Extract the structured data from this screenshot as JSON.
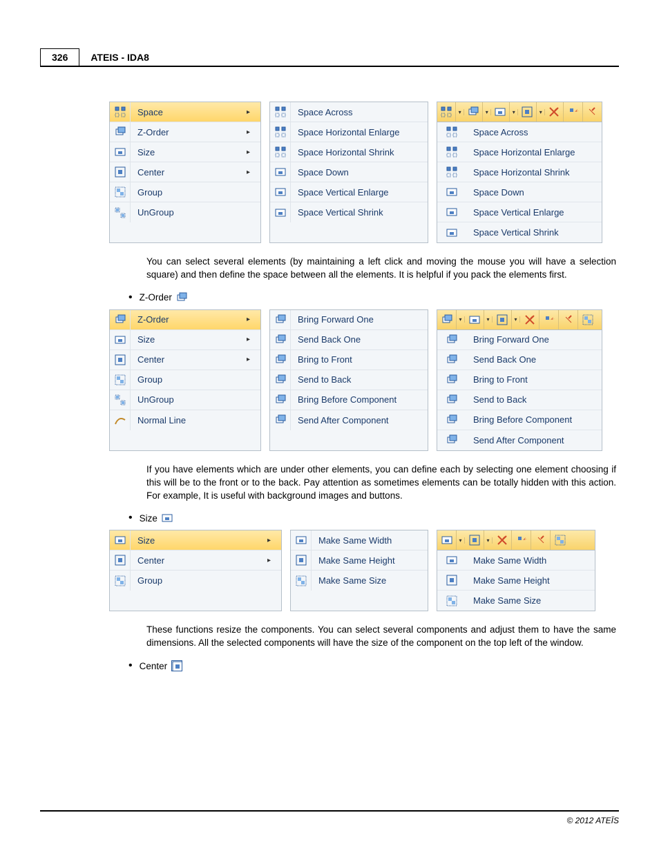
{
  "header": {
    "page_number": "326",
    "title": "ATEIS - IDA8"
  },
  "section1": {
    "menu1": [
      {
        "label": "Space",
        "selected": true,
        "arrow": true
      },
      {
        "label": "Z-Order",
        "arrow": true
      },
      {
        "label": "Size",
        "arrow": true
      },
      {
        "label": "Center",
        "arrow": true
      },
      {
        "label": "Group"
      },
      {
        "label": "UnGroup"
      }
    ],
    "menu2": [
      {
        "label": "Space Across"
      },
      {
        "label": "Space Horizontal Enlarge"
      },
      {
        "label": "Space Horizontal Shrink"
      },
      {
        "label": "Space Down"
      },
      {
        "label": "Space Vertical Enlarge"
      },
      {
        "label": "Space Vertical Shrink"
      }
    ],
    "panel": [
      {
        "label": "Space Across"
      },
      {
        "label": "Space Horizontal Enlarge"
      },
      {
        "label": "Space Horizontal Shrink"
      },
      {
        "label": "Space Down"
      },
      {
        "label": "Space Vertical Enlarge"
      },
      {
        "label": "Space Vertical Shrink"
      }
    ],
    "paragraph": "You can select several elements (by maintaining a left click and moving the mouse you will have a selection square) and then define the space between all the elements. It is helpful if you pack the elements first."
  },
  "section2": {
    "bullet": "Z-Order",
    "menu1": [
      {
        "label": "Z-Order",
        "selected": true,
        "arrow": true
      },
      {
        "label": "Size",
        "arrow": true
      },
      {
        "label": "Center",
        "arrow": true
      },
      {
        "label": "Group"
      },
      {
        "label": "UnGroup"
      },
      {
        "label": "Normal Line"
      }
    ],
    "menu2": [
      {
        "label": "Bring Forward One"
      },
      {
        "label": "Send Back One"
      },
      {
        "label": "Bring to Front"
      },
      {
        "label": "Send to Back"
      },
      {
        "label": "Bring Before Component"
      },
      {
        "label": "Send After Component"
      }
    ],
    "panel": [
      {
        "label": "Bring Forward One"
      },
      {
        "label": "Send Back One"
      },
      {
        "label": "Bring to Front"
      },
      {
        "label": "Send to Back"
      },
      {
        "label": "Bring Before Component"
      },
      {
        "label": "Send After Component"
      }
    ],
    "paragraph": "If you have elements which are under other elements, you can define each by selecting one element choosing if this will be to the front or to the back. Pay attention as sometimes elements can be totally hidden with this action. For example, It is useful with background images and buttons."
  },
  "section3": {
    "bullet": "Size",
    "menu1": [
      {
        "label": "Size",
        "selected": true,
        "arrow": true
      },
      {
        "label": "Center",
        "arrow": true
      },
      {
        "label": "Group"
      }
    ],
    "menu2": [
      {
        "label": "Make Same Width"
      },
      {
        "label": "Make Same Height"
      },
      {
        "label": "Make Same Size"
      }
    ],
    "panel": [
      {
        "label": "Make Same Width"
      },
      {
        "label": "Make Same Height"
      },
      {
        "label": "Make Same Size"
      }
    ],
    "paragraph": "These functions resize the components. You can select several components and adjust them to have the same dimensions.  All the selected components will have the size of the component on the top left of the window."
  },
  "section4": {
    "bullet": "Center"
  },
  "footer": "© 2012 ATEÏS",
  "icons": {
    "space": "space-icon",
    "zorder": "zorder-icon",
    "size": "size-icon",
    "center": "center-icon",
    "group": "group-icon",
    "ungroup": "ungroup-icon",
    "normal_line": "normal-line-icon",
    "arrow_right": "▸"
  }
}
